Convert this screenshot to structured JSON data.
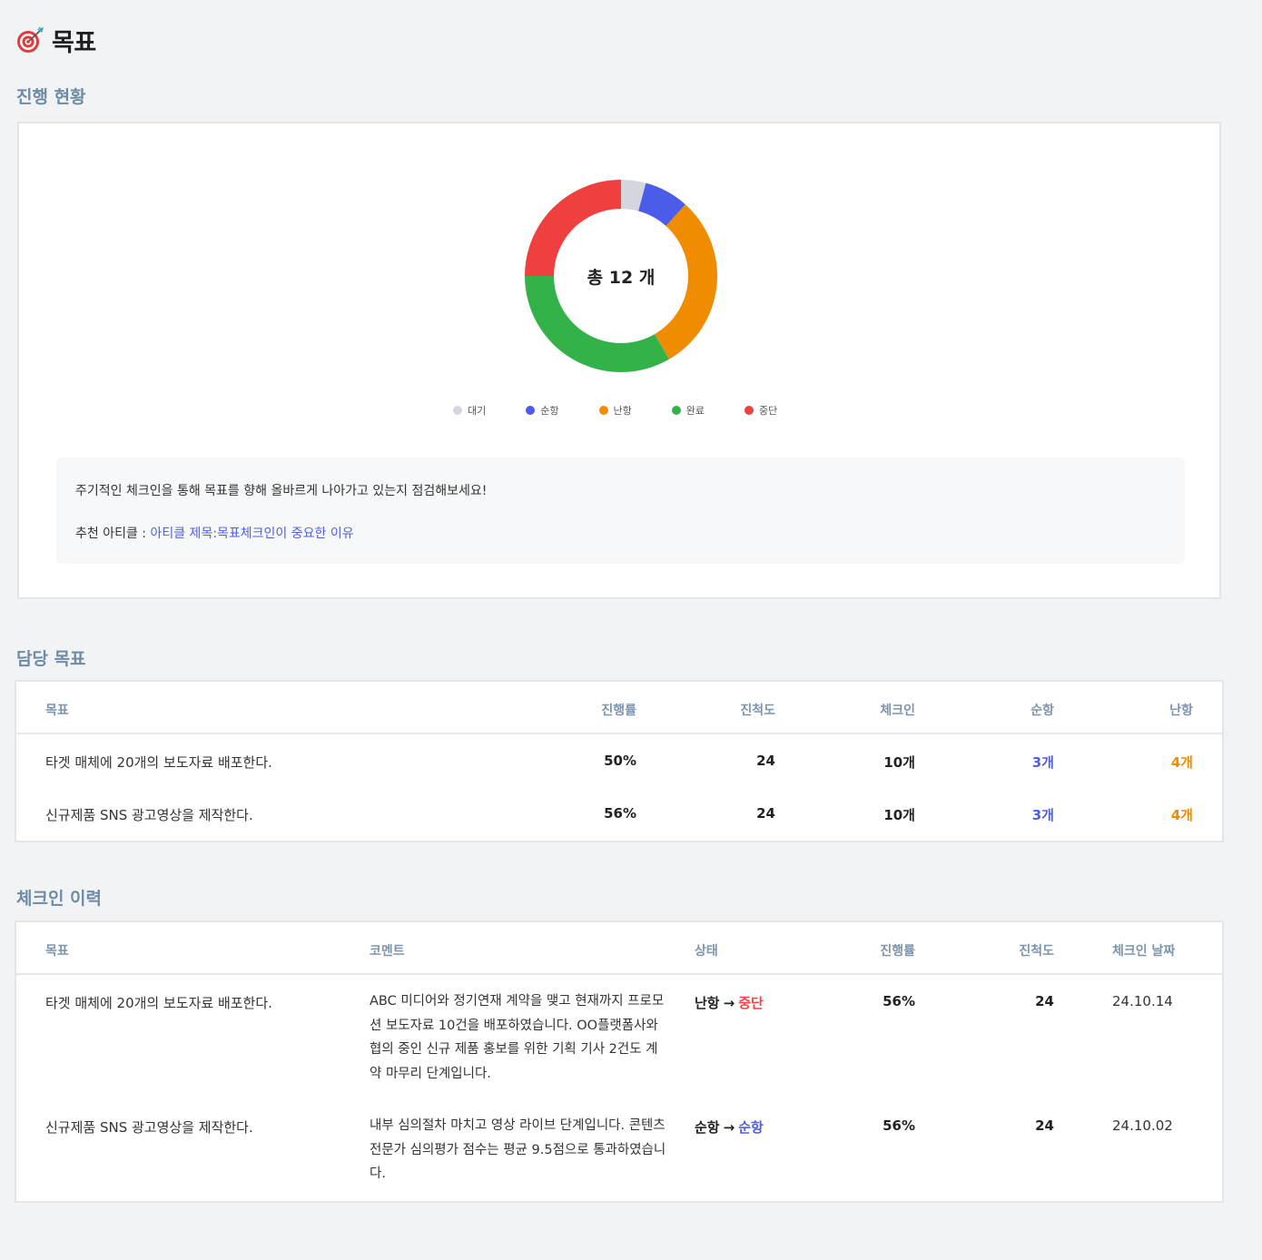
{
  "header": {
    "title": "목표",
    "icon": "target-dart-icon"
  },
  "sections": {
    "progress": "진행 현황",
    "goals": "담당 목표",
    "history": "체크인 이력"
  },
  "chart_data": {
    "type": "pie",
    "donut": true,
    "center_label": "총 12 개",
    "categories": [
      "대기",
      "순항",
      "난항",
      "완료",
      "중단"
    ],
    "values": [
      0.5,
      0.9,
      3.6,
      4.0,
      3.0
    ],
    "colors": [
      "#d3d6dc",
      "#4a5ce8",
      "#f08c00",
      "#34b24a",
      "#ef3f3f"
    ],
    "legend_position": "bottom"
  },
  "tip": {
    "line1": "주기적인 체크인을 통해 목표를 향해 올바르게 나아가고 있는지 점검해보세요!",
    "line2_prefix": "추천 아티클 : ",
    "link_text": "아티클 제목:목표체크인이 중요한 이유"
  },
  "goals_table": {
    "headers": [
      "목표",
      "진행률",
      "진척도",
      "체크인",
      "순항",
      "난항"
    ],
    "rows": [
      {
        "goal": "타겟 매체에 20개의 보도자료 배포한다.",
        "rate": "50%",
        "progress": "24",
        "checkin": "10개",
        "smooth": "3개",
        "rough": "4개"
      },
      {
        "goal": "신규제품 SNS 광고영상을 제작한다.",
        "rate": "56%",
        "progress": "24",
        "checkin": "10개",
        "smooth": "3개",
        "rough": "4개"
      }
    ]
  },
  "history_table": {
    "headers": [
      "목표",
      "코멘트",
      "상태",
      "진행률",
      "진척도",
      "체크인 날짜"
    ],
    "rows": [
      {
        "goal": "타겟 매체에 20개의 보도자료 배포한다.",
        "comment": "ABC 미디어와 정기연재 계약을 맺고 현재까지 프로모션 보도자료 10건을 배포하였습니다. OO플랫폼사와 협의 중인 신규 제품 홍보를 위한 기획 기사 2건도 계약 마무리 단계입니다.",
        "status_from": "난항",
        "status_arrow": "→",
        "status_to": "중단",
        "status_to_color": "#ee4646",
        "rate": "56%",
        "progress": "24",
        "date": "24.10.14"
      },
      {
        "goal": "신규제품 SNS 광고영상을 제작한다.",
        "comment": "내부 심의절차 마치고 영상 라이브 단계입니다. 콘텐츠 전문가 심의평가 점수는 평균 9.5점으로 통과하였습니다.",
        "status_from": "순항",
        "status_arrow": "→",
        "status_to": "순항",
        "status_to_color": "#4f5fe0",
        "rate": "56%",
        "progress": "24",
        "date": "24.10.02"
      }
    ]
  }
}
